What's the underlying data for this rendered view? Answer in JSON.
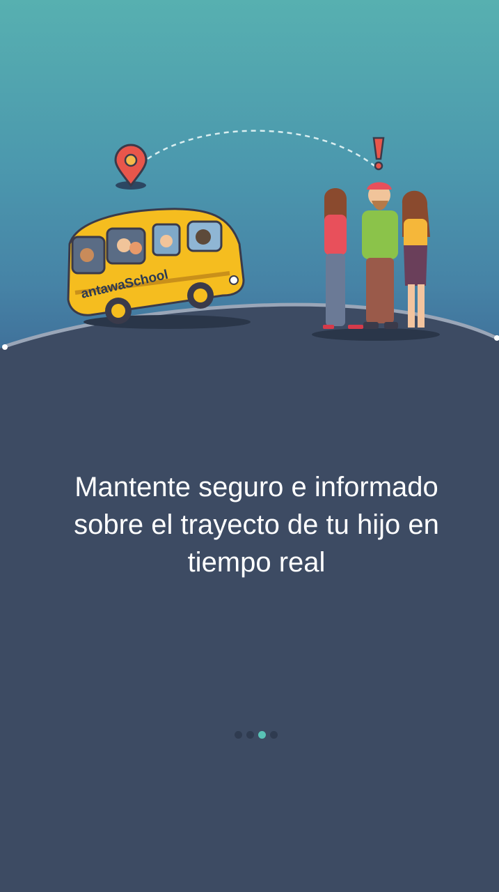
{
  "onboarding": {
    "bus_brand": "antawaSchool",
    "message": "Mantente seguro e informado sobre el trayecto de tu hijo en tiempo real",
    "pagination": {
      "total": 4,
      "active_index": 2
    }
  },
  "colors": {
    "background": "#3d4b63",
    "sky_top": "#57b0b0",
    "bus": "#f5bd1f",
    "pin": "#e8564b",
    "dot_active": "#59c2b6",
    "dot_inactive": "#2f3b50"
  }
}
